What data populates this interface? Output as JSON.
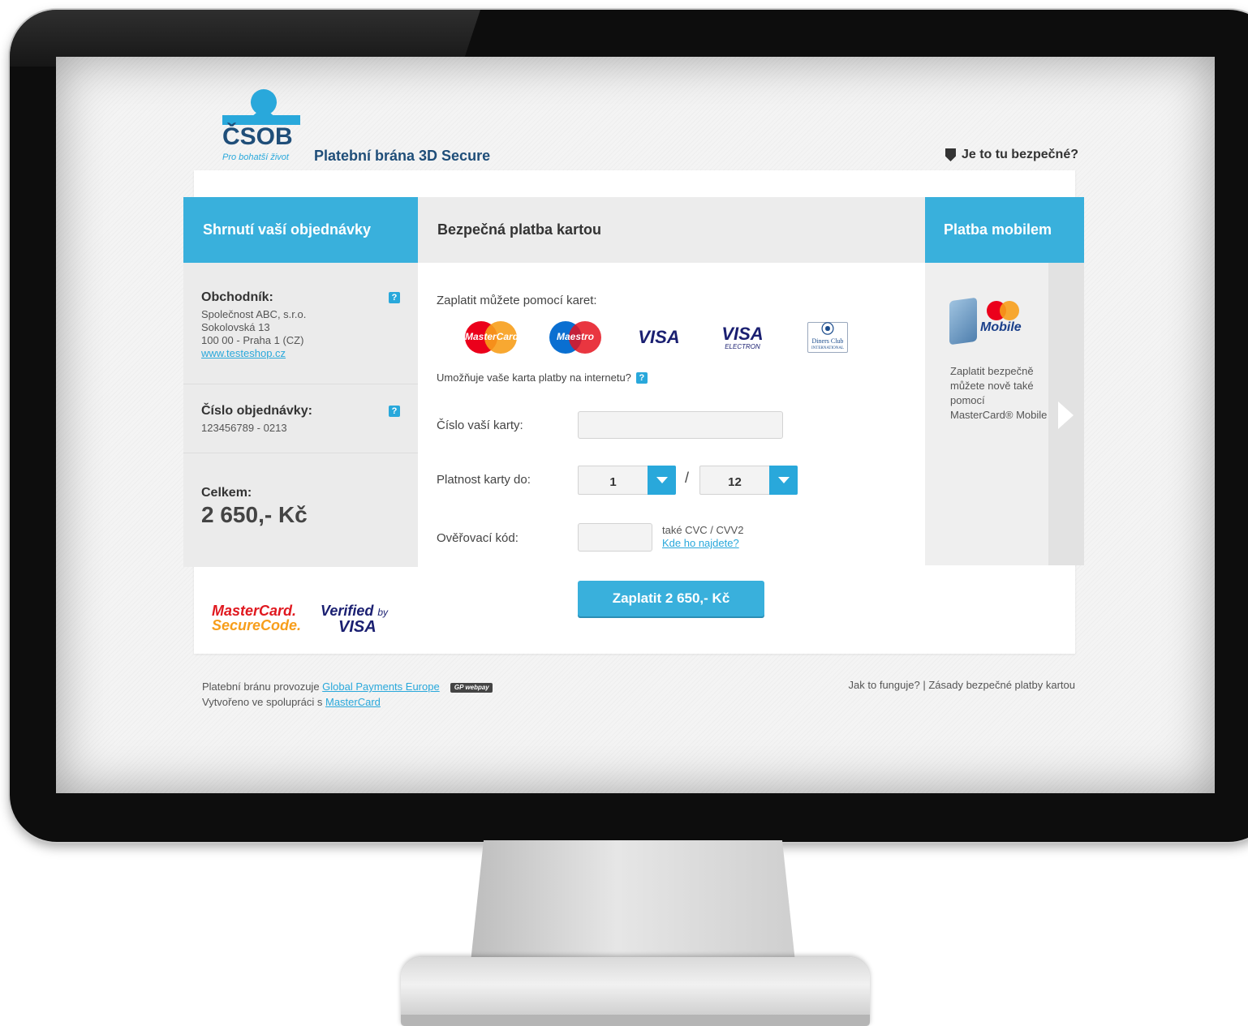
{
  "header": {
    "logo_text": "ČSOB",
    "logo_slogan": "Pro bohatší život",
    "gateway_title": "Platební brána 3D Secure",
    "safety_link": "Je to tu bezpečné?"
  },
  "summary": {
    "title": "Shrnutí vaší objednávky",
    "merchant_label": "Obchodník:",
    "merchant_lines": [
      "Společnost ABC, s.r.o.",
      "Sokolovská 13",
      "100 00 - Praha 1 (CZ)"
    ],
    "merchant_url": "www.testeshop.cz",
    "order_label": "Číslo objednávky:",
    "order_number": "123456789 - 0213",
    "total_label": "Celkem:",
    "total_value": "2 650,- Kč",
    "help_glyph": "?"
  },
  "payment": {
    "title": "Bezpečná platba kartou",
    "pay_with": "Zaplatit můžete pomocí karet:",
    "brands": {
      "mastercard": "MasterCard",
      "maestro": "Maestro",
      "visa": "VISA",
      "visa_electron": "VISA",
      "visa_electron_sub": "ELECTRON",
      "diners": "Diners Club",
      "diners_sub": "INTERNATIONAL"
    },
    "internet_question": "Umožňuje vaše karta platby na internetu?",
    "card_number_label": "Číslo vaší karty:",
    "card_number_value": "",
    "expiry_label": "Platnost karty do:",
    "expiry_month": "1",
    "expiry_separator": "/",
    "expiry_year": "12",
    "cvc_label": "Ověřovací kód:",
    "cvc_value": "",
    "cvc_note": "také CVC / CVV2",
    "cvc_link": "Kde ho najdete?",
    "pay_button": "Zaplatit 2 650,- Kč"
  },
  "mobile": {
    "title": "Platba mobilem",
    "logo_word": "Mobile",
    "text": "Zaplatit bezpečně můžete nově také pomocí MasterCard® Mobile"
  },
  "secure_logos": {
    "mc_line1": "MasterCard.",
    "mc_line2": "SecureCode.",
    "vbv_line1": "Verified",
    "vbv_by": "by",
    "vbv_line2": "VISA"
  },
  "footer": {
    "operator_prefix": "Platební bránu provozuje",
    "operator_link": "Global Payments Europe",
    "gp_badge": "GP webpay",
    "coop_prefix": "Vytvořeno ve spolupráci s",
    "coop_link": "MasterCard",
    "right_links": "Jak to funguje? | Zásady bezpečné platby kartou"
  },
  "colors": {
    "accent": "#39b0dc",
    "brand_dark": "#1f4e79",
    "mastercard_red": "#eb001b",
    "mastercard_orange": "#f79e1b",
    "visa_blue": "#1a1f71"
  }
}
